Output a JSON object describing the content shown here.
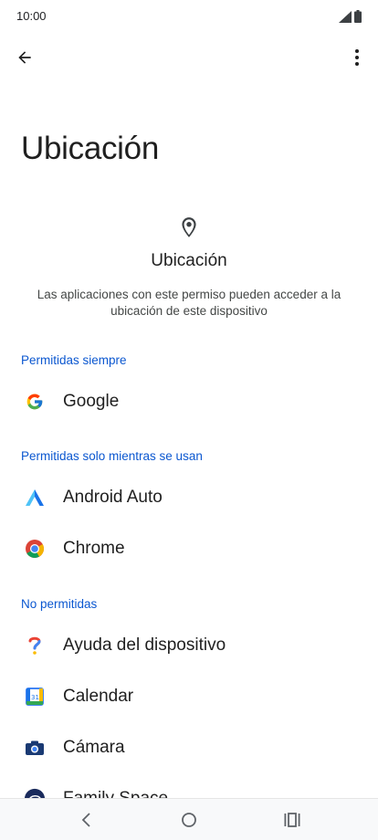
{
  "status": {
    "time": "10:00"
  },
  "page": {
    "title": "Ubicación"
  },
  "header": {
    "title": "Ubicación",
    "description": "Las aplicaciones con este permiso pueden acceder a la ubicación de este dispositivo"
  },
  "sections": {
    "always": {
      "label": "Permitidas siempre",
      "apps": [
        "Google"
      ]
    },
    "while_in_use": {
      "label": "Permitidas solo mientras se usan",
      "apps": [
        "Android Auto",
        "Chrome"
      ]
    },
    "denied": {
      "label": "No permitidas",
      "apps": [
        "Ayuda del dispositivo",
        "Calendar",
        "Cámara",
        "Family Space"
      ]
    }
  },
  "icons": {
    "back": "arrow-left-icon",
    "more": "more-vert-icon",
    "location": "location-pin-icon"
  },
  "colors": {
    "accent": "#0b57d0",
    "text": "#1f1f1f"
  }
}
